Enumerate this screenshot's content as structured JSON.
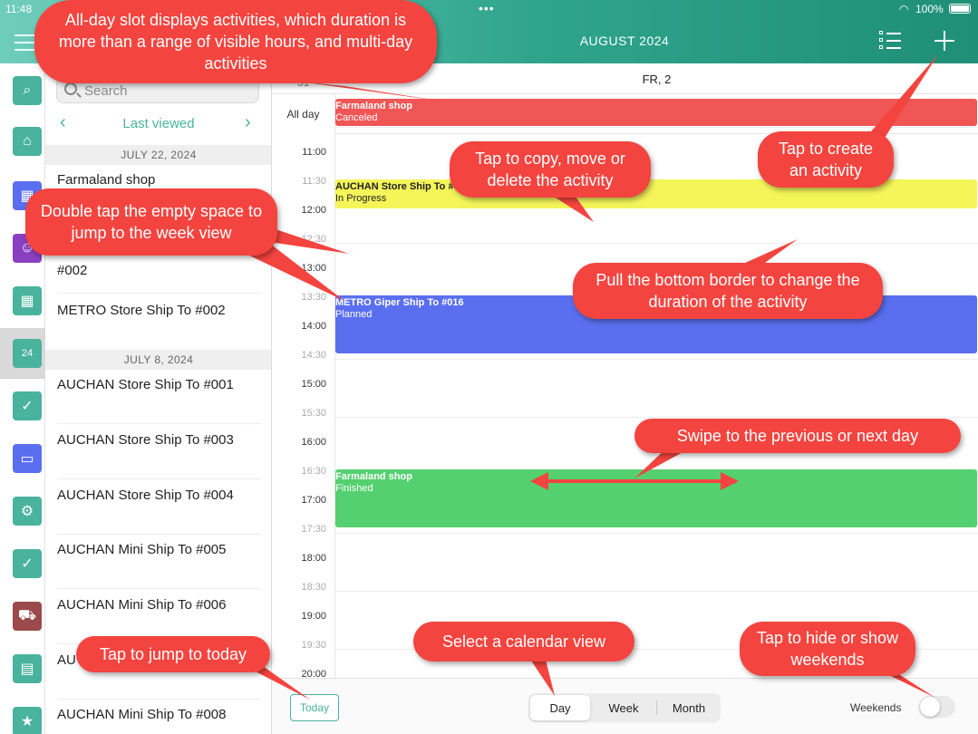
{
  "status_bar": {
    "time": "11:48",
    "dots": "•••",
    "battery": "100%"
  },
  "header": {
    "title": "AUGUST 2024"
  },
  "sidebar": {
    "search_placeholder": "Search",
    "nav_label": "Last viewed",
    "nav_prev": "‹",
    "nav_next": "›",
    "sections": [
      {
        "date": "JULY 22, 2024",
        "items": [
          "Farmaland shop",
          "AUCHAN Store Ship To #002",
          "METRO Store Ship To #002"
        ]
      },
      {
        "date": "JULY 8, 2024",
        "items": [
          "AUCHAN Store Ship To #001",
          "AUCHAN Store Ship To #003",
          "AUCHAN Store Ship To #004",
          "AUCHAN Mini Ship To #005",
          "AUCHAN Mini Ship To #006",
          "AUCHAN Mini Ship To #007",
          "AUCHAN Mini Ship To #008"
        ]
      }
    ],
    "visible_fragments": {
      "item_partial": "#002",
      "item7_partial": "AU"
    }
  },
  "calendar": {
    "prev_day": "31",
    "day_header": "FR,   2",
    "allday_label": "All day",
    "times": [
      "11:00",
      "11:30",
      "12:00",
      "12:30",
      "13:00",
      "13:30",
      "14:00",
      "14:30",
      "15:00",
      "15:30",
      "16:00",
      "16:30",
      "17:00",
      "17:30",
      "18:00",
      "18:30",
      "19:00",
      "19:30",
      "20:00"
    ],
    "events": [
      {
        "title": "Farmaland shop",
        "status": "Canceled",
        "color": "#f05656",
        "text_color": "#ffffff",
        "allday": true
      },
      {
        "title": "AUCHAN Store Ship To #002",
        "status": "In Progress",
        "color": "#f5f55a",
        "text_color": "#222222",
        "start": "12:00",
        "end": "12:30"
      },
      {
        "title": "METRO Giper Ship To #016",
        "status": "Planned",
        "color": "#5a6ff0",
        "text_color": "#ffffff",
        "start": "14:00",
        "end": "15:00"
      },
      {
        "title": "Farmaland shop",
        "status": "Finished",
        "color": "#55d070",
        "text_color": "#ffffff",
        "start": "17:00",
        "end": "18:00"
      }
    ]
  },
  "bottom": {
    "today_label": "Today",
    "views": [
      "Day",
      "Week",
      "Month"
    ],
    "selected_view": "Day",
    "weekends_label": "Weekends",
    "weekends_on": false
  },
  "callouts": {
    "allday": "All-day slot displays activities, which duration is more than a range of visible hours, and multi-day activities",
    "copy": "Tap to copy, move or delete the activity",
    "create": "Tap to create an activity",
    "double_tap": "Double tap the empty space to jump to the week view",
    "pull": "Pull the bottom border to change the duration of the activity",
    "swipe": "Swipe to the previous or next day",
    "today": "Tap to jump to today",
    "select_view": "Select a calendar view",
    "weekends": "Tap to hide or show weekends"
  },
  "colors": {
    "accent": "#49b39d",
    "callout": "#f4443f"
  },
  "rail_icons": [
    "search-icon",
    "home-icon",
    "building-icon",
    "contacts-icon",
    "calendar-grid-icon",
    "calendar-24-icon",
    "clipboard-icon",
    "presentation-icon",
    "settings-icon",
    "checklist-icon",
    "cart-icon",
    "document-icon",
    "star-badge-icon"
  ]
}
